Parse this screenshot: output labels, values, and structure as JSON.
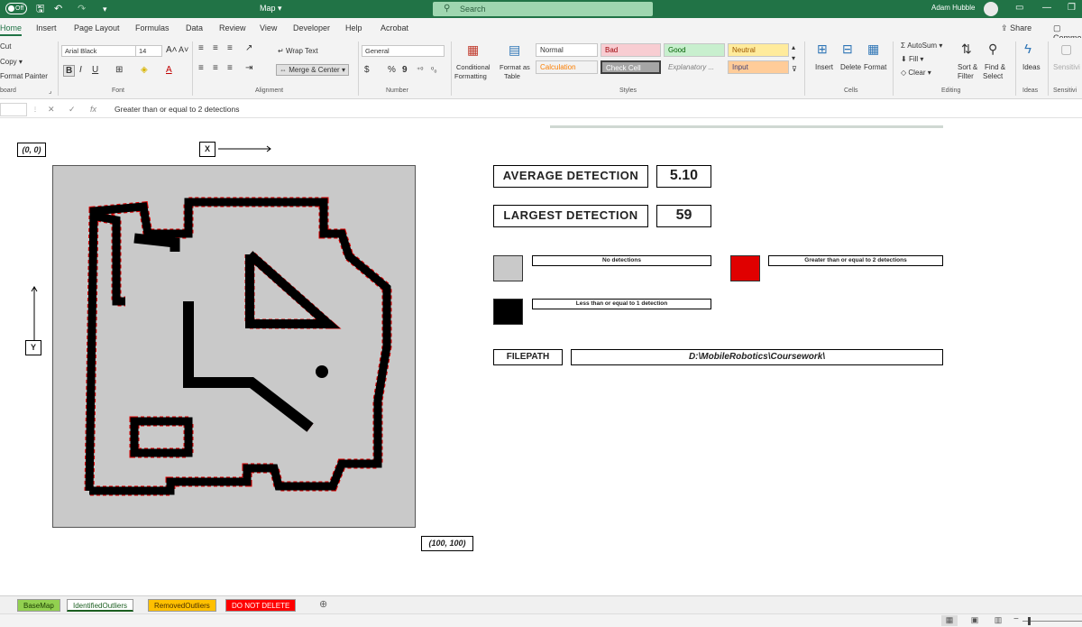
{
  "titlebar": {
    "autosave": "Off",
    "doc_title": "Map",
    "doc_chevron": "▾",
    "search_placeholder": "Search",
    "user_name": "Adam Hubble",
    "icons": [
      "save-icon",
      "undo-icon",
      "redo-icon",
      "customize-icon"
    ]
  },
  "menu": {
    "tabs": [
      "Home",
      "Insert",
      "Page Layout",
      "Formulas",
      "Data",
      "Review",
      "View",
      "Developer",
      "Help",
      "Acrobat"
    ],
    "share": "Share",
    "comments": "Comme"
  },
  "ribbon": {
    "clipboard": {
      "cut": "Cut",
      "copy": "Copy",
      "format_painter": "Format Painter",
      "label": "board"
    },
    "font": {
      "name": "Arial Black",
      "size": "14",
      "label": "Font",
      "bold": "B",
      "italic": "I",
      "underline": "U"
    },
    "alignment": {
      "wrap": "Wrap Text",
      "merge": "Merge & Center",
      "label": "Alignment"
    },
    "number": {
      "format": "General",
      "label": "Number",
      "currency": "$",
      "percent": "%",
      "comma": "9"
    },
    "styles": {
      "conditional": "Conditional",
      "conditional2": "Formatting",
      "format_as": "Format as",
      "format_as2": "Table",
      "label": "Styles",
      "cells": [
        {
          "text": "Normal",
          "bg": "#ffffff",
          "fg": "#333333"
        },
        {
          "text": "Bad",
          "bg": "#f8cdd2",
          "fg": "#9c0006"
        },
        {
          "text": "Good",
          "bg": "#c8efce",
          "fg": "#006100"
        },
        {
          "text": "Neutral",
          "bg": "#ffeb9c",
          "fg": "#9c5700"
        },
        {
          "text": "Calculation",
          "bg": "#f2f2f2",
          "fg": "#fa7d00"
        },
        {
          "text": "Check Cell",
          "bg": "#a5a5a5",
          "fg": "#ffffff"
        },
        {
          "text": "Explanatory ...",
          "bg": "#f3f3f3",
          "fg": "#7f7f7f"
        },
        {
          "text": "Input",
          "bg": "#ffcc99",
          "fg": "#3f3f76"
        }
      ]
    },
    "cells": {
      "insert": "Insert",
      "delete": "Delete",
      "format": "Format",
      "label": "Cells"
    },
    "editing": {
      "autosum": "AutoSum",
      "fill": "Fill",
      "clear": "Clear",
      "sort": "Sort &",
      "sort2": "Filter",
      "find": "Find &",
      "find2": "Select",
      "label": "Editing"
    },
    "ideas": {
      "text": "Ideas",
      "label": "Ideas"
    },
    "sensitivity": {
      "text": "Sensitivi",
      "label": "Sensitivi"
    }
  },
  "formula_bar": {
    "cancel": "✕",
    "enter": "✓",
    "fx": "fx",
    "content": "Greater than or equal to 2 detections"
  },
  "sheet": {
    "origin_label": "(0, 0)",
    "x_label": "X",
    "y_label": "Y",
    "end_label": "(100, 100)",
    "avg_label": "AVERAGE DETECTION",
    "avg_value": "5.10",
    "max_label": "LARGEST DETECTION",
    "max_value": "59",
    "legend": [
      {
        "text": "No detections",
        "color": "#c9c9c9"
      },
      {
        "text": "Greater than or equal to 2 detections",
        "color": "#e00000"
      },
      {
        "text": "Less than or equal to 1 detection",
        "color": "#000000"
      }
    ],
    "filepath_label": "FILEPATH",
    "filepath_value": "D:\\MobileRobotics\\Coursework\\"
  },
  "sheet_tabs": [
    {
      "text": "BaseMap",
      "bg": "#92d050",
      "fg": "#1a3c00"
    },
    {
      "text": "IdentifiedOutliers",
      "bg": "#ffffff",
      "fg": "#1b5e20"
    },
    {
      "text": "RemovedOutliers",
      "bg": "#ffc000",
      "fg": "#4a3000"
    },
    {
      "text": "DO NOT DELETE",
      "bg": "#ff0000",
      "fg": "#ffffff"
    }
  ],
  "add_sheet": "⊕"
}
